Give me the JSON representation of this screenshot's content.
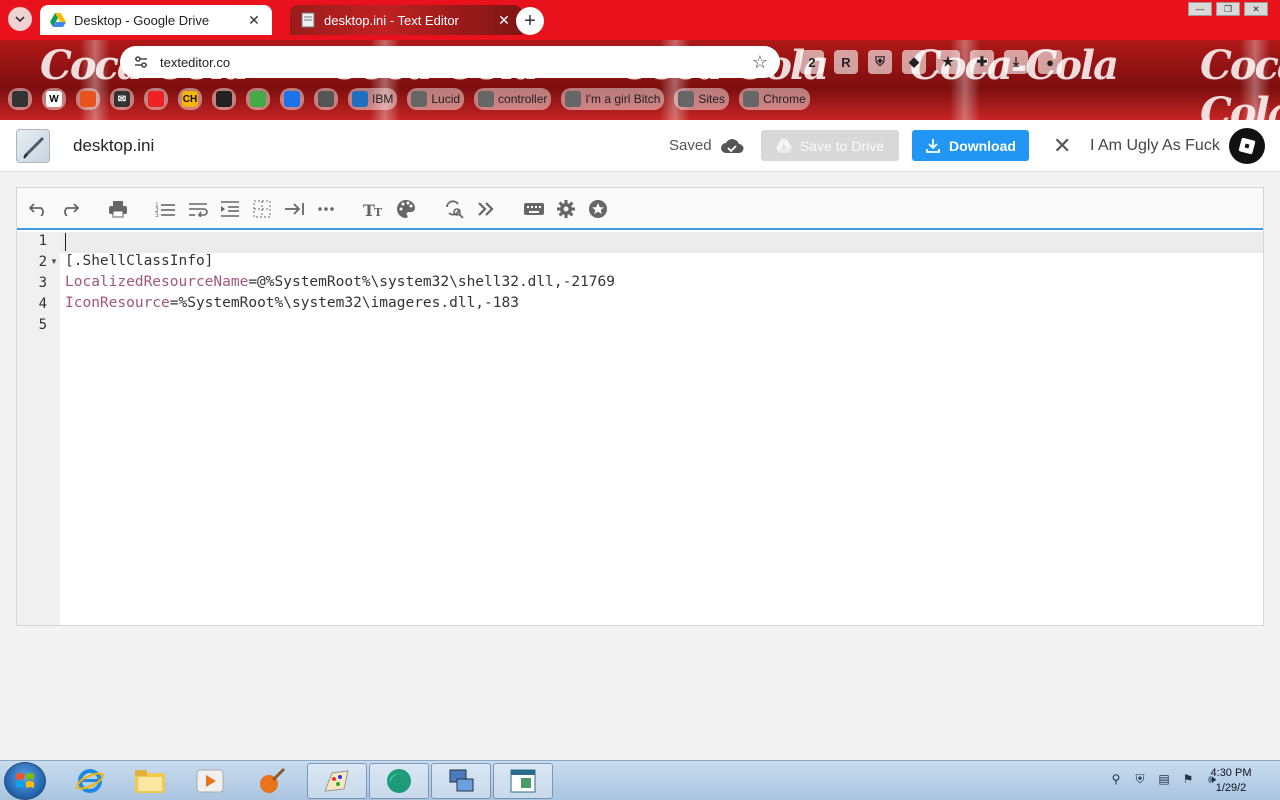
{
  "browser": {
    "tabs": [
      {
        "title": "Desktop - Google Drive",
        "active": true
      },
      {
        "title": "desktop.ini - Text Editor",
        "active": false
      }
    ],
    "url": "texteditor.co",
    "theme_logo": "Coca-Cola",
    "bookmarks": [
      {
        "icon": "W",
        "label": ""
      },
      {
        "icon": "CH",
        "label": ""
      },
      {
        "icon": "",
        "label": "IBM"
      },
      {
        "icon": "",
        "label": "Lucid"
      },
      {
        "icon": "",
        "label": "controller"
      },
      {
        "icon": "",
        "label": "I'm a girl Bitch"
      },
      {
        "icon": "",
        "label": "Sites"
      },
      {
        "icon": "",
        "label": "Chrome"
      }
    ],
    "extensions": [
      "2",
      "R"
    ]
  },
  "app": {
    "filename": "desktop.ini",
    "saved_label": "Saved",
    "save_to_drive_label": "Save to Drive",
    "download_label": "Download",
    "username": "I Am Ugly As Fuck"
  },
  "editor": {
    "lines": [
      {
        "num": "1",
        "key": "",
        "val": ""
      },
      {
        "num": "2",
        "key": "",
        "val": "[.ShellClassInfo]"
      },
      {
        "num": "3",
        "key": "LocalizedResourceName",
        "val": "=@%SystemRoot%\\system32\\shell32.dll,-21769"
      },
      {
        "num": "4",
        "key": "IconResource",
        "val": "=%SystemRoot%\\system32\\imageres.dll,-183"
      },
      {
        "num": "5",
        "key": "",
        "val": ""
      }
    ]
  },
  "taskbar": {
    "time": "4:30 PM",
    "date": "1/29/2"
  },
  "colors": {
    "tabbar": "#e8111c",
    "download_button": "#2196f3",
    "editor_accent": "#3d9be5",
    "ini_key": "#a0577c"
  }
}
